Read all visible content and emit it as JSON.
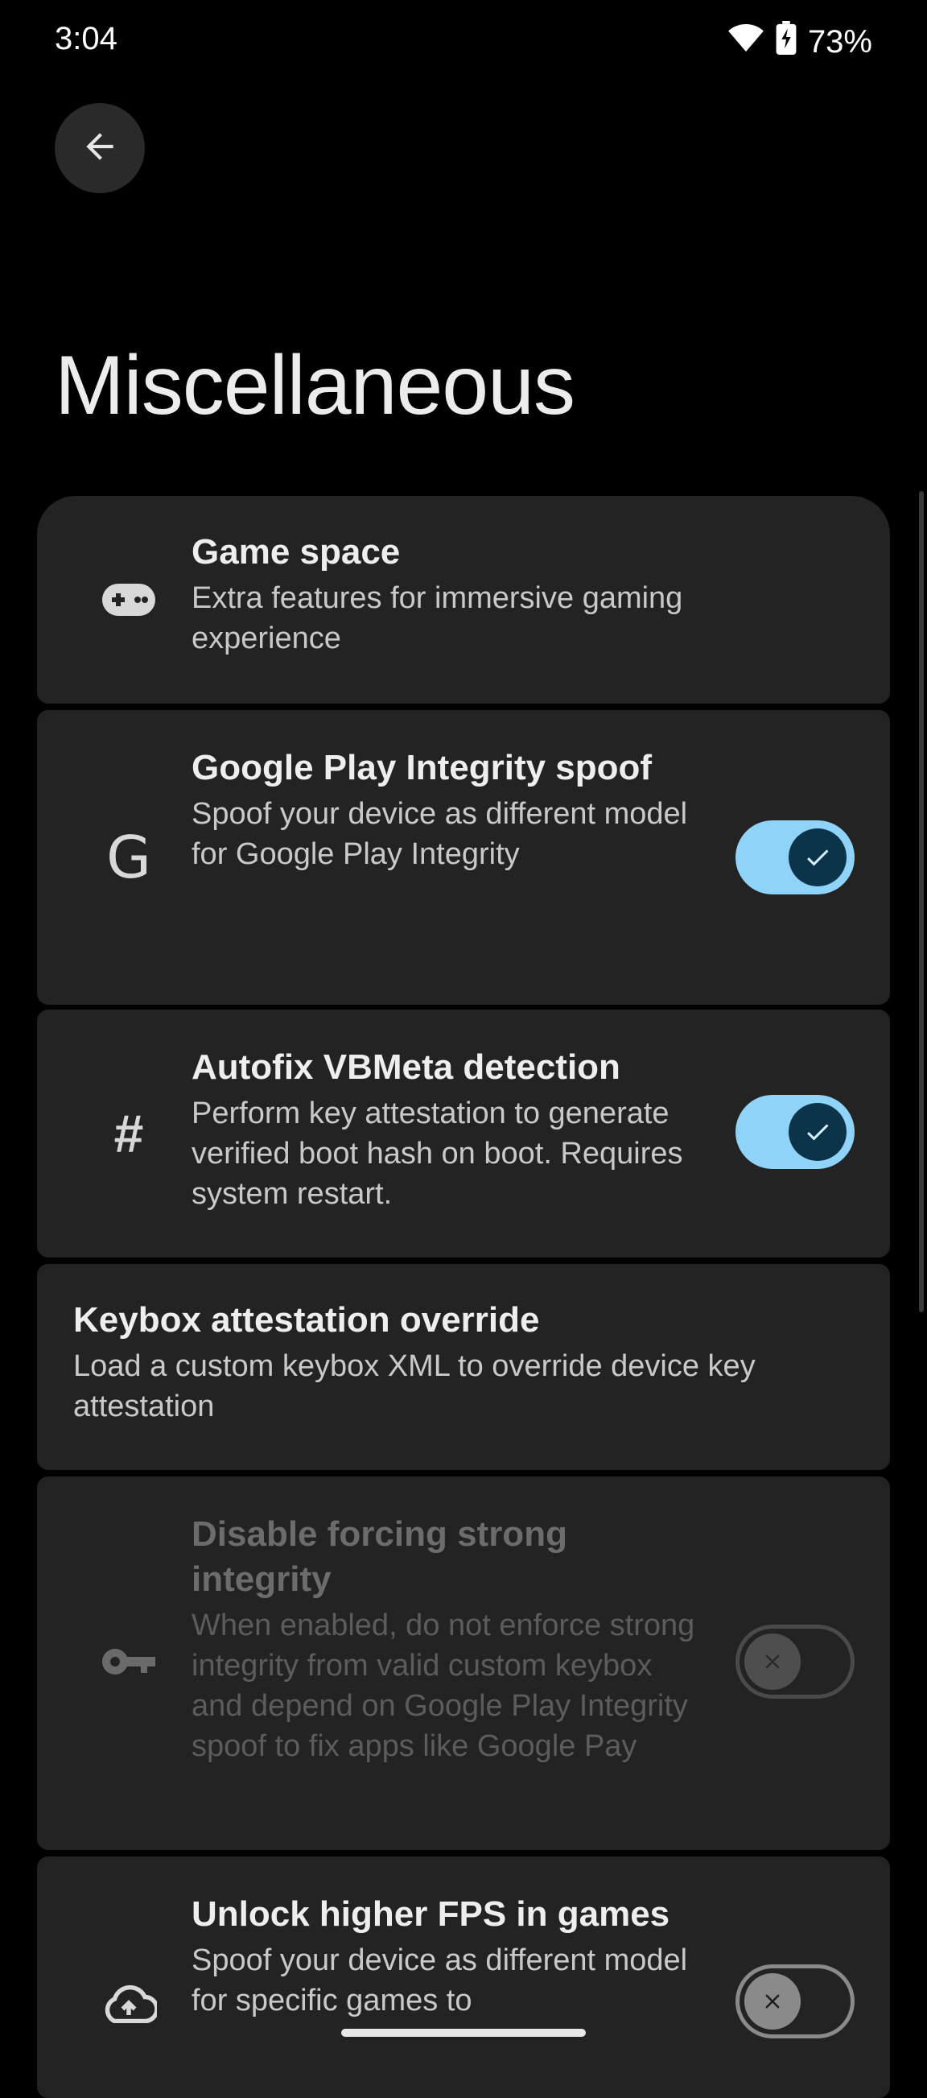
{
  "status_bar": {
    "time": "3:04",
    "battery_percent": "73%",
    "icons": [
      "wifi-icon",
      "battery-charging-icon"
    ]
  },
  "header": {
    "back_icon": "arrow-left-icon",
    "title": "Miscellaneous"
  },
  "settings": [
    {
      "icon": "gamepad-icon",
      "title": "Game space",
      "subtitle": "Extra features for immersive gaming experience",
      "toggle": null
    },
    {
      "icon": "google-g-icon",
      "icon_text": "G",
      "title": "Google Play Integrity spoof",
      "subtitle": "Spoof your device as different model for Google Play Integrity",
      "toggle": "on"
    },
    {
      "icon": "hash-icon",
      "icon_text": "#",
      "title": "Autofix VBMeta detection",
      "subtitle": "Perform key attestation to generate verified boot hash on boot. Requires system restart.",
      "toggle": "on"
    },
    {
      "icon": null,
      "title": "Keybox attestation override",
      "subtitle": "Load a custom keybox XML to override device key attestation",
      "toggle": null
    },
    {
      "icon": "key-icon",
      "title": "Disable forcing strong integrity",
      "subtitle": "When enabled, do not enforce strong integrity from valid custom keybox and depend on Google Play Integrity spoof to fix apps like Google Pay",
      "toggle": "off",
      "disabled": true
    },
    {
      "icon": "cloud-upload-icon",
      "title": "Unlock higher FPS in games",
      "subtitle": "Spoof your device as different model for specific games to",
      "toggle": "off"
    }
  ],
  "colors": {
    "background": "#000000",
    "card": "#232323",
    "toggle_on_track": "#8fd3f8",
    "toggle_on_knob": "#0b3349",
    "toggle_off": "#8a8a8a"
  }
}
